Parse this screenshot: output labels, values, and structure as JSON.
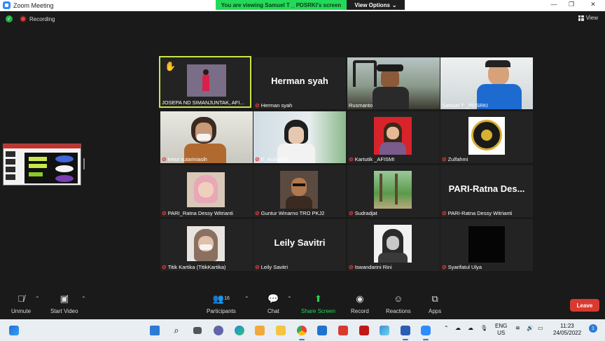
{
  "window": {
    "title": "Zoom Meeting",
    "share_banner": "You are viewing Samuel T _ PDSRKI's screen",
    "view_options": "View Options",
    "controls": [
      "—",
      "❐",
      "✕"
    ]
  },
  "status": {
    "recording": "Recording",
    "view": "View"
  },
  "participants": [
    {
      "name": "JOSEPA ND SIMANJUNTAK, AFI...",
      "muted": false,
      "hand_raised": true,
      "active": true,
      "video": "presenter"
    },
    {
      "name": "Herman syah",
      "muted": true,
      "display_text": "Herman syah"
    },
    {
      "name": "Rusmanto",
      "muted": false,
      "video": "photo"
    },
    {
      "name": "Samuel T _PDSRKI",
      "muted": false,
      "video": "photo"
    },
    {
      "name": "ketut sutariniasih",
      "muted": true,
      "video": "photo"
    },
    {
      "name": "E_Kunarsih",
      "muted": true,
      "video": "photo"
    },
    {
      "name": "Kartutik _AFISMI",
      "muted": true,
      "video": "photo"
    },
    {
      "name": "Zulfahmi",
      "muted": true,
      "video": "logo"
    },
    {
      "name": "PARI_Ratna Dessy Witrianti",
      "muted": true,
      "video": "photo"
    },
    {
      "name": "Guntur Winarno TRO PKJ2",
      "muted": true,
      "video": "photo"
    },
    {
      "name": "Sudradjat",
      "muted": true,
      "video": "photo"
    },
    {
      "name": "PARI-Ratna Dessy Witrianti",
      "muted": true,
      "display_text": "PARI-Ratna Des..."
    },
    {
      "name": "Titik Kartika (TitikKartika)",
      "muted": true,
      "video": "photo"
    },
    {
      "name": "Leily Savitri",
      "muted": true,
      "display_text": "Leily Savitri"
    },
    {
      "name": "Iswandarini Rini",
      "muted": true,
      "video": "photo"
    },
    {
      "name": "Syarifatul Ulya",
      "muted": true,
      "video": "black"
    }
  ],
  "toolbar": {
    "unmute": "Unmute",
    "start_video": "Start Video",
    "participants": "Participants",
    "participants_count": "16",
    "chat": "Chat",
    "share_screen": "Share Screen",
    "record": "Record",
    "reactions": "Reactions",
    "apps": "Apps",
    "leave": "Leave"
  },
  "taskbar": {
    "lang_top": "ENG",
    "lang_bottom": "US",
    "time": "11:23",
    "date": "24/05/2022",
    "notifications": "1"
  },
  "colors": {
    "share_banner_bg": "#23d959",
    "active_speaker_border": "#c9e54a",
    "leave_bg": "#d93a2f",
    "share_screen_green": "#23d959"
  }
}
